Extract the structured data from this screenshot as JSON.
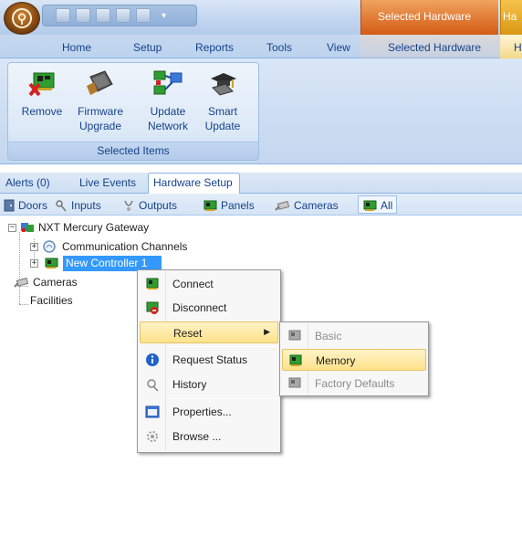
{
  "title_bar": {
    "context_tab_1": "Selected Hardware",
    "context_tab_2": "Ha"
  },
  "ribbon_tabs": [
    "Home",
    "Setup",
    "Reports",
    "Tools",
    "View",
    "Selected Hardware",
    "H"
  ],
  "ribbon": {
    "group_label": "Selected Items",
    "buttons": [
      {
        "line1": "Remove",
        "line2": ""
      },
      {
        "line1": "Firmware",
        "line2": "Upgrade"
      },
      {
        "line1": "Update",
        "line2": "Network"
      },
      {
        "line1": "Smart",
        "line2": "Update"
      }
    ]
  },
  "doc_tabs": [
    "Alerts (0)",
    "Live Events",
    "Hardware Setup"
  ],
  "filters": [
    "Doors",
    "Inputs",
    "Outputs",
    "Panels",
    "Cameras",
    "All"
  ],
  "tree": {
    "root": "NXT Mercury Gateway",
    "child_1": "Communication Channels",
    "child_2": "New Controller 1",
    "node_cameras": "Cameras",
    "node_facilities": "Facilities"
  },
  "context_menu": {
    "connect": "Connect",
    "disconnect": "Disconnect",
    "reset": "Reset",
    "request_status": "Request Status",
    "history": "History",
    "properties": "Properties...",
    "browse": "Browse ..."
  },
  "submenu": {
    "basic": "Basic",
    "memory": "Memory",
    "factory_defaults": "Factory Defaults"
  },
  "icons": {
    "remove": "remove-board-icon",
    "firmware": "firmware-chip-icon",
    "network": "update-network-icon",
    "smart": "smart-update-icon"
  },
  "colors": {
    "context_tab": "#d35b14",
    "selection": "#3399ff",
    "menu_highlight": "#fde28a"
  }
}
